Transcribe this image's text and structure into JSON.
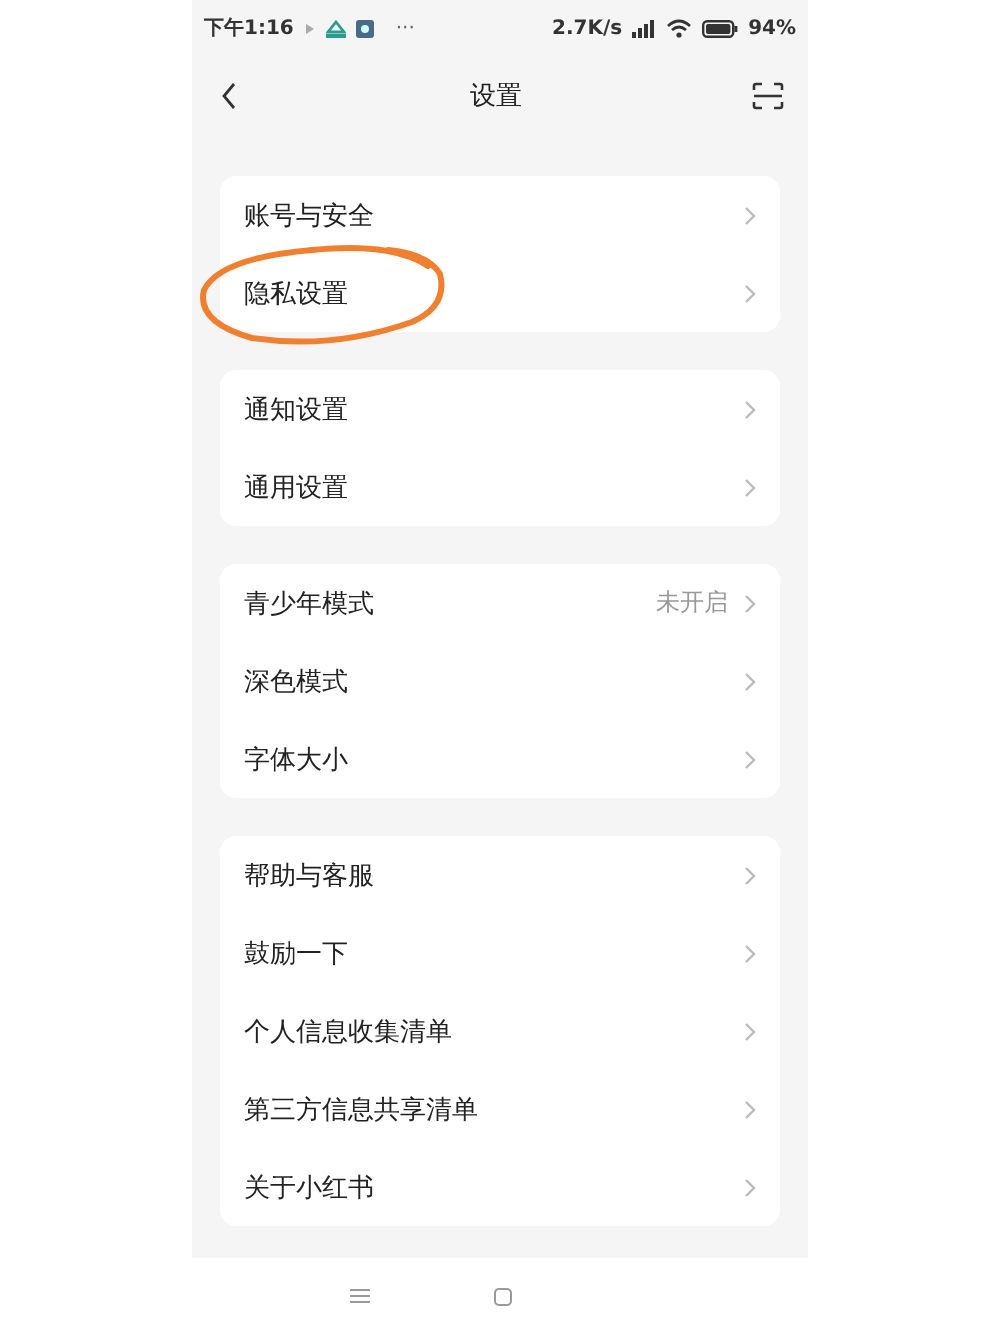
{
  "status_bar": {
    "time": "下午1:16",
    "more": "···",
    "speed": "2.7K/s",
    "battery": "94%"
  },
  "header": {
    "title": "设置"
  },
  "groups": [
    {
      "items": [
        {
          "label": "账号与安全",
          "circled": false
        },
        {
          "label": "隐私设置",
          "circled": true
        }
      ]
    },
    {
      "items": [
        {
          "label": "通知设置",
          "circled": false
        },
        {
          "label": "通用设置",
          "circled": false
        }
      ]
    },
    {
      "items": [
        {
          "label": "青少年模式",
          "value": "未开启",
          "circled": false
        },
        {
          "label": "深色模式",
          "circled": false
        },
        {
          "label": "字体大小",
          "circled": false
        }
      ]
    },
    {
      "items": [
        {
          "label": "帮助与客服",
          "circled": false
        },
        {
          "label": "鼓励一下",
          "circled": false
        },
        {
          "label": "个人信息收集清单",
          "circled": false
        },
        {
          "label": "第三方信息共享清单",
          "circled": false
        },
        {
          "label": "关于小红书",
          "circled": false
        }
      ]
    }
  ]
}
